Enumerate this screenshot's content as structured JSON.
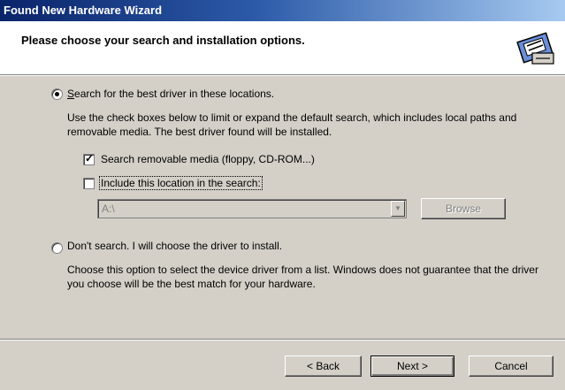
{
  "window": {
    "title": "Found New Hardware Wizard"
  },
  "header": {
    "title": "Please choose your search and installation options.",
    "icon": "hardware-install-icon"
  },
  "options": {
    "search": {
      "label": "Search for the best driver in these locations.",
      "description": "Use the check boxes below to limit or expand the default search, which includes local paths and removable media. The best driver found will be installed.",
      "selected": true
    },
    "removable_media": {
      "label": "Search removable media (floppy, CD-ROM...)",
      "checked": true
    },
    "include_location": {
      "label": "Include this location in the search:",
      "checked": false
    },
    "location": {
      "value": "A:\\"
    },
    "browse_label": "Browse",
    "dont_search": {
      "label": "Don't search. I will choose the driver to install.",
      "description": "Choose this option to select the device driver from a list.  Windows does not guarantee that the driver you choose will be the best match for your hardware.",
      "selected": false
    }
  },
  "footer": {
    "back_label": "< Back",
    "next_label": "Next >",
    "cancel_label": "Cancel"
  }
}
